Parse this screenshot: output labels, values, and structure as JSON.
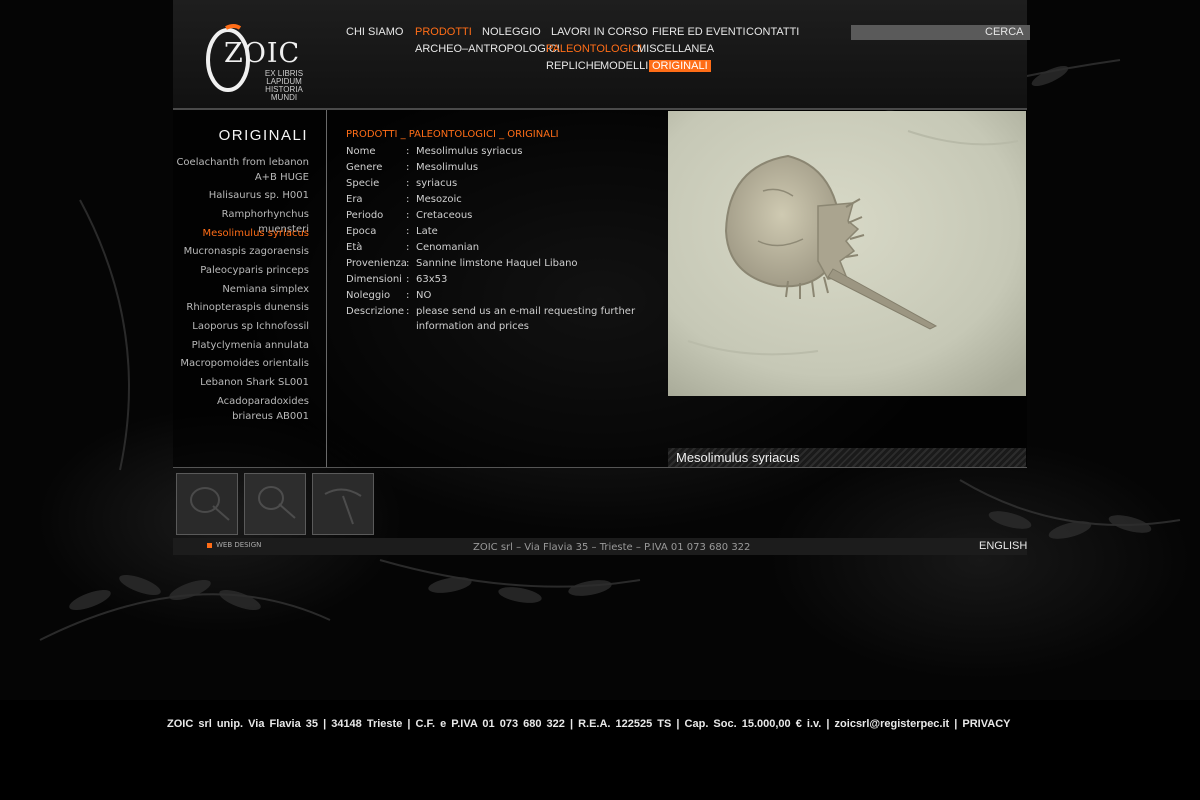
{
  "logo": {
    "name": "ZOIC",
    "motto_line1": "EX LIBRIS LAPIDUM",
    "motto_line2": "HISTORIA MUNDI"
  },
  "nav": {
    "main": [
      "CHI SIAMO",
      "PRODOTTI",
      "NOLEGGIO",
      "LAVORI IN CORSO",
      "FIERE ED EVENTI",
      "CONTATTI"
    ],
    "sub": [
      "ARCHEO–ANTROPOLOGICI",
      "PALEONTOLOGICI",
      "MISCELLANEA"
    ],
    "subsub": [
      "REPLICHE",
      "MODELLI",
      "ORIGINALI"
    ],
    "active": {
      "main": "PRODOTTI",
      "sub": "PALEONTOLOGICI",
      "subsub": "ORIGINALI"
    }
  },
  "search": {
    "label": "CERCA",
    "value": ""
  },
  "sidebar": {
    "title": "ORIGINALI",
    "items": [
      {
        "label": "Coelachanth from lebanon A+B HUGE"
      },
      {
        "label": "Halisaurus sp. H001"
      },
      {
        "label": "Ramphorhynchus muensteri"
      },
      {
        "label": "Mesolimulus syriacus",
        "active": true
      },
      {
        "label": "Mucronaspis zagoraensis"
      },
      {
        "label": "Paleocyparis princeps"
      },
      {
        "label": "Nemiana simplex"
      },
      {
        "label": "Rhinopteraspis dunensis"
      },
      {
        "label": "Laoporus sp  Ichnofossil"
      },
      {
        "label": "Platyclymenia annulata"
      },
      {
        "label": "Macropomoides orientalis"
      },
      {
        "label": "Lebanon Shark SL001"
      },
      {
        "label": "Acadoparadoxides briareus AB001"
      }
    ]
  },
  "breadcrumb": "PRODOTTI _ PALEONTOLOGICI _ ORIGINALI",
  "specs": [
    {
      "label": "Nome",
      "value": "Mesolimulus syriacus"
    },
    {
      "label": "Genere",
      "value": "Mesolimulus"
    },
    {
      "label": "Specie",
      "value": "syriacus"
    },
    {
      "label": "Era",
      "value": "Mesozoic"
    },
    {
      "label": "Periodo",
      "value": "Cretaceous"
    },
    {
      "label": "Epoca",
      "value": "Late"
    },
    {
      "label": "Età",
      "value": "Cenomanian"
    },
    {
      "label": "Provenienza",
      "value": "Sannine limstone Haquel Libano"
    },
    {
      "label": "Dimensioni",
      "value": "63x53"
    },
    {
      "label": "Noleggio",
      "value": "NO"
    },
    {
      "label": "Descrizione",
      "value": "please send us an e-mail requesting further information and prices"
    }
  ],
  "photo_caption": "Mesolimulus syriacus",
  "footer": {
    "web_design": "WEB DESIGN",
    "company_line": "ZOIC srl  –  Via Flavia 35  –  Trieste  –  P.IVA 01 073 680 322",
    "language": "ENGLISH",
    "legal": "ZOIC srl unip. Via Flavia 35 | 34148 Trieste | C.F. e P.IVA 01 073 680 322 | R.E.A. 122525 TS | Cap. Soc. 15.000,00 € i.v. | zoicsrl@registerpec.it |",
    "privacy": "PRIVACY"
  },
  "colors": {
    "accent": "#ff6d17",
    "background": "#000000",
    "header": "#1a1a1a"
  }
}
